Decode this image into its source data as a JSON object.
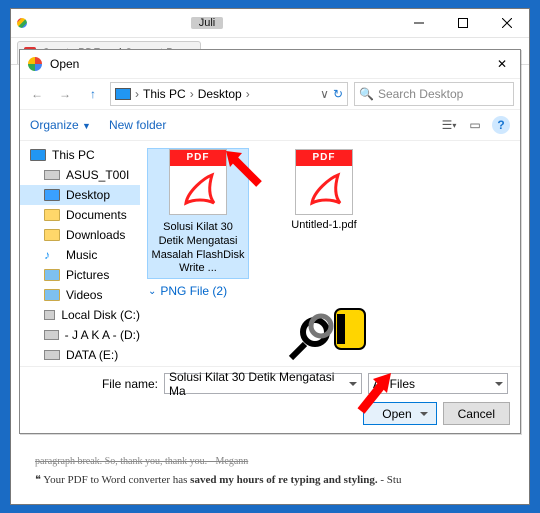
{
  "window": {
    "title_label": "Juli",
    "tab_title": "Create PDF and Convert P..."
  },
  "dialog": {
    "title": "Open",
    "breadcrumb": [
      "This PC",
      "Desktop"
    ],
    "search_placeholder": "Search Desktop",
    "toolbar": {
      "organize": "Organize",
      "new_folder": "New folder"
    },
    "tree": [
      {
        "label": "This PC",
        "type": "monitor",
        "sub": false,
        "sel": false
      },
      {
        "label": "ASUS_T00I",
        "type": "drive",
        "sub": true,
        "sel": false
      },
      {
        "label": "Desktop",
        "type": "monitor",
        "sub": true,
        "sel": true
      },
      {
        "label": "Documents",
        "type": "folder",
        "sub": true,
        "sel": false
      },
      {
        "label": "Downloads",
        "type": "folder",
        "sub": true,
        "sel": false
      },
      {
        "label": "Music",
        "type": "folder",
        "sub": true,
        "sel": false
      },
      {
        "label": "Pictures",
        "type": "folder",
        "sub": true,
        "sel": false
      },
      {
        "label": "Videos",
        "type": "folder",
        "sub": true,
        "sel": false
      },
      {
        "label": "Local Disk (C:)",
        "type": "drive",
        "sub": true,
        "sel": false
      },
      {
        "label": "- J A K A - (D:)",
        "type": "drive",
        "sub": true,
        "sel": false
      },
      {
        "label": "DATA (E:)",
        "type": "drive",
        "sub": true,
        "sel": false
      }
    ],
    "files": [
      {
        "name": "Solusi Kilat 30 Detik Mengatasi Masalah FlashDisk Write ...",
        "selected": true
      },
      {
        "name": "Untitled-1.pdf",
        "selected": false
      }
    ],
    "section": "PNG File (2)",
    "file_name_label": "File name:",
    "file_name_value": "Solusi Kilat 30 Detik Mengatasi Ma",
    "filter": "All Files",
    "open": "Open",
    "cancel": "Cancel"
  },
  "back": {
    "line1": "paragraph break. So, thank you, thank you. - Megann",
    "line2a": "Your PDF to Word converter has ",
    "line2b": "saved my hours of re typing and styling.",
    "line2c": " - Stu"
  }
}
